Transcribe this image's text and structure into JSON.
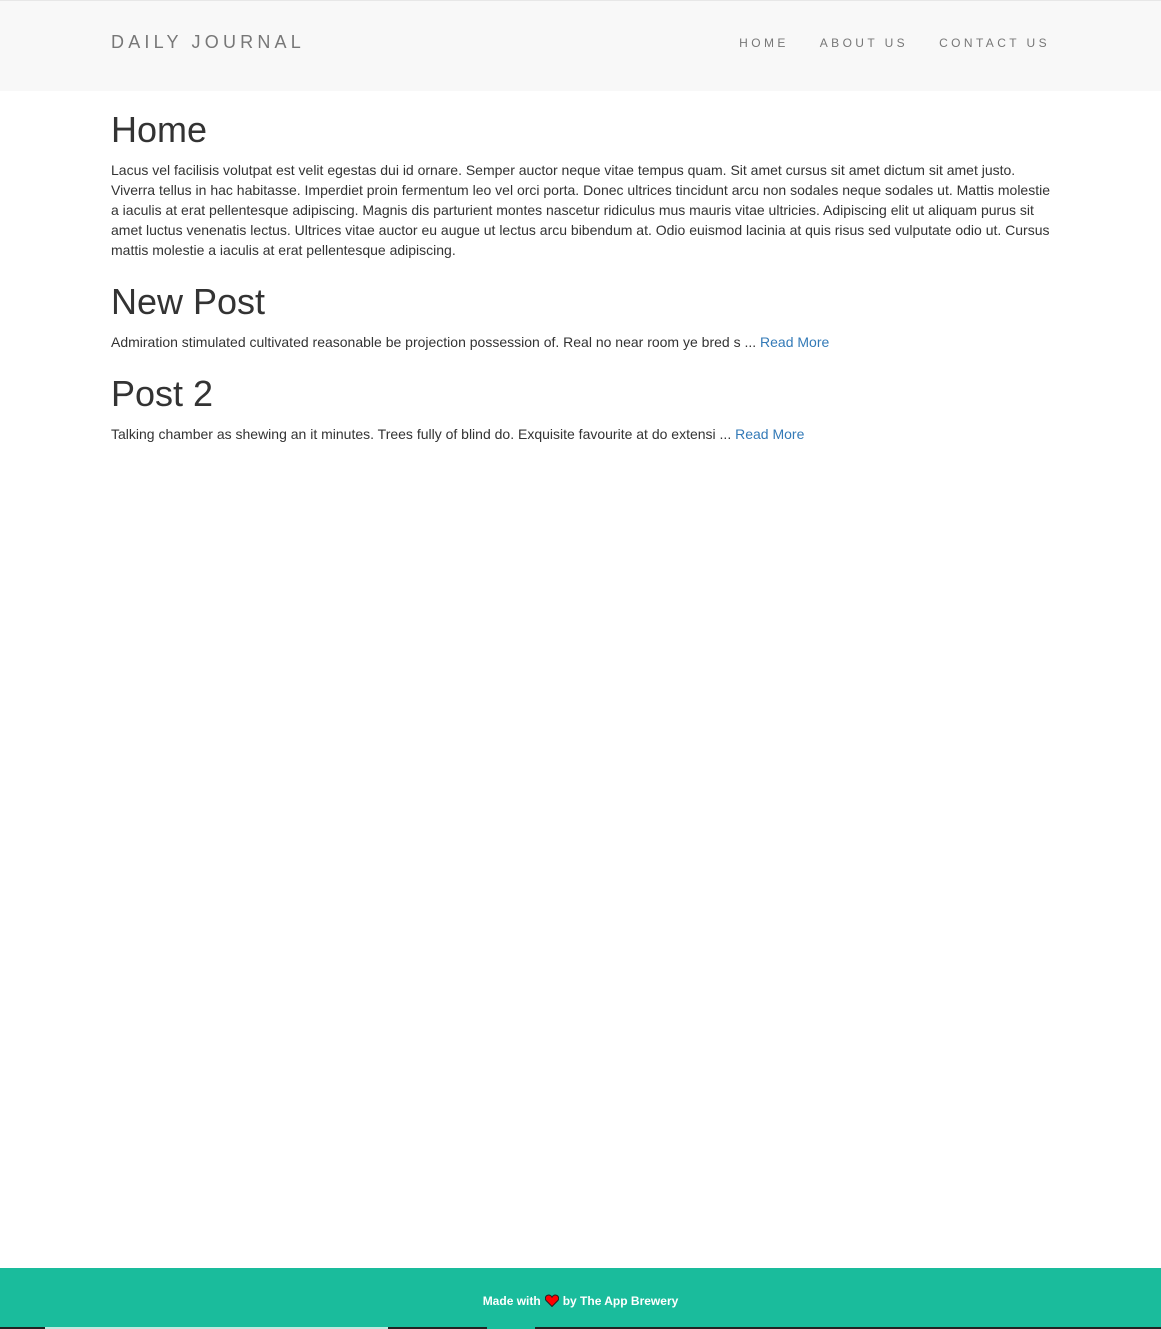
{
  "navbar": {
    "brand": "DAILY JOURNAL",
    "links": [
      {
        "label": "HOME"
      },
      {
        "label": "ABOUT US"
      },
      {
        "label": "CONTACT US"
      }
    ]
  },
  "home": {
    "title": "Home",
    "content": "Lacus vel facilisis volutpat est velit egestas dui id ornare. Semper auctor neque vitae tempus quam. Sit amet cursus sit amet dictum sit amet justo. Viverra tellus in hac habitasse. Imperdiet proin fermentum leo vel orci porta. Donec ultrices tincidunt arcu non sodales neque sodales ut. Mattis molestie a iaculis at erat pellentesque adipiscing. Magnis dis parturient montes nascetur ridiculus mus mauris vitae ultricies. Adipiscing elit ut aliquam purus sit amet luctus venenatis lectus. Ultrices vitae auctor eu augue ut lectus arcu bibendum at. Odio euismod lacinia at quis risus sed vulputate odio ut. Cursus mattis molestie a iaculis at erat pellentesque adipiscing."
  },
  "posts": [
    {
      "title": "New Post",
      "excerpt": "Admiration stimulated cultivated reasonable be projection possession of. Real no near room ye bred s ... ",
      "read_more": "Read More"
    },
    {
      "title": "Post 2",
      "excerpt": "Talking chamber as shewing an it minutes. Trees fully of blind do. Exquisite favourite at do extensi ... ",
      "read_more": "Read More"
    }
  ],
  "footer": {
    "made_with": "Made with",
    "icon": "heart-icon",
    "by": "by The App Brewery",
    "heart_color": "#ff0000"
  }
}
